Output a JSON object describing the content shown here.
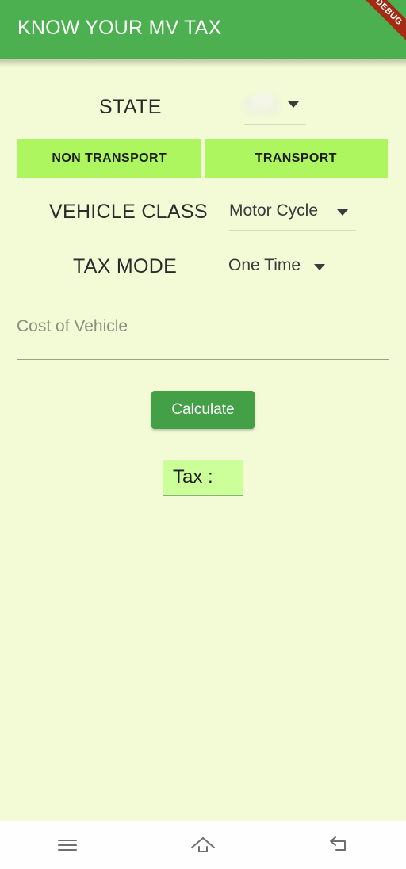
{
  "app": {
    "title": "KNOW YOUR MV TAX",
    "banner_text": "DEBUG",
    "header_color": "#4CAF50",
    "background_color": "#F2FAD6",
    "tab_color": "#AEF65F",
    "button_color": "#43A047",
    "result_color": "#CCFF99"
  },
  "form": {
    "state": {
      "label": "STATE",
      "value": "",
      "caret_icon": "chevron-down-icon"
    },
    "tabs": [
      {
        "label": "NON TRANSPORT"
      },
      {
        "label": "TRANSPORT"
      }
    ],
    "vehicle_class": {
      "label": "VEHICLE CLASS",
      "value": "Motor Cycle",
      "caret_icon": "chevron-down-icon"
    },
    "tax_mode": {
      "label": "TAX MODE",
      "value": "One Time",
      "caret_icon": "chevron-down-icon"
    },
    "cost": {
      "placeholder": "Cost of Vehicle",
      "value": ""
    },
    "calculate_label": "Calculate",
    "result_label": "Tax :"
  },
  "navbar": {
    "recents_icon": "menu-icon",
    "home_icon": "home-icon",
    "back_icon": "back-arrow-icon"
  }
}
